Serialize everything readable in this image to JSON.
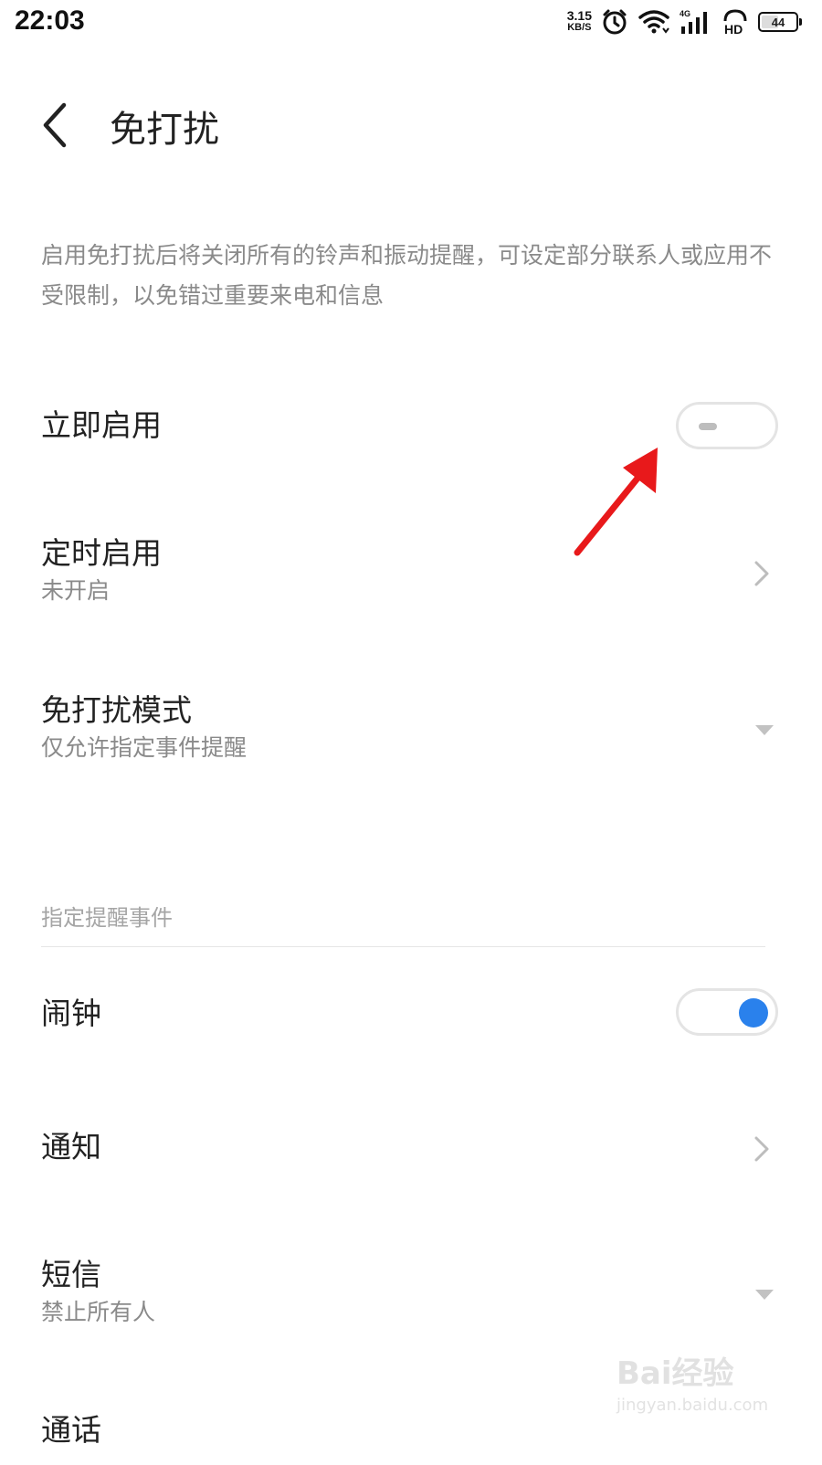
{
  "status_bar": {
    "time": "22:03",
    "net_speed_value": "3.15",
    "net_speed_unit": "KB/S",
    "network_type": "4G",
    "hd_label": "HD",
    "battery_level": "44",
    "icons": [
      "alarm-icon",
      "wifi-icon",
      "signal-icon",
      "hd-icon",
      "battery-icon"
    ]
  },
  "header": {
    "title": "免打扰"
  },
  "description": "启用免打扰后将关闭所有的铃声和振动提醒，可设定部分联系人或应用不受限制，以免错过重要来电和信息",
  "settings": {
    "enable_now": {
      "label": "立即启用",
      "enabled": false
    },
    "scheduled": {
      "label": "定时启用",
      "value": "未开启"
    },
    "mode": {
      "label": "免打扰模式",
      "value": "仅允许指定事件提醒"
    }
  },
  "section_header": "指定提醒事件",
  "events": {
    "alarm": {
      "label": "闹钟",
      "enabled": true
    },
    "notification": {
      "label": "通知"
    },
    "sms": {
      "label": "短信",
      "value": "禁止所有人"
    },
    "call": {
      "label": "通话"
    }
  },
  "watermark": {
    "brand": "Bai经验",
    "url": "jingyan.baidu.com"
  },
  "colors": {
    "accent": "#2a81ec",
    "annotation_arrow": "#e8191b",
    "secondary_text": "#8a8a8a"
  }
}
